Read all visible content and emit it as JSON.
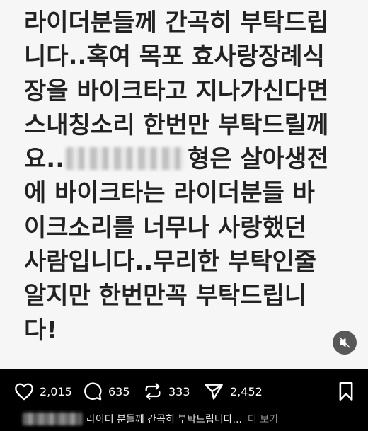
{
  "post": {
    "lines": [
      "라이더분들께 간곡히 부탁드립",
      "니다..혹여 목포 효사랑장례식",
      "장을 바이크타고 지나가신다면",
      "스내칭소리 한번만 부탁드릴께",
      "형은 살아생전",
      "에 바이크타는 라이더분들 바",
      "이크소리를 너무나 사랑했던",
      "사람입니다..무리한 부탁인줄",
      "알지만 한번만꼭 부탁드립니",
      "다!"
    ],
    "line5_prefix": "요.."
  },
  "media": {
    "mute_icon": "speaker-muted-icon"
  },
  "actions": {
    "likes": "2,015",
    "comments": "635",
    "reposts": "333",
    "shares": "2,452",
    "like_icon": "heart-icon",
    "comment_icon": "comment-bubble-icon",
    "repost_icon": "repost-icon",
    "share_icon": "send-icon",
    "save_icon": "bookmark-icon"
  },
  "caption": {
    "text": "라이더 분들께 간곡히 부탁드립니다...",
    "more_label": "더 보기"
  }
}
